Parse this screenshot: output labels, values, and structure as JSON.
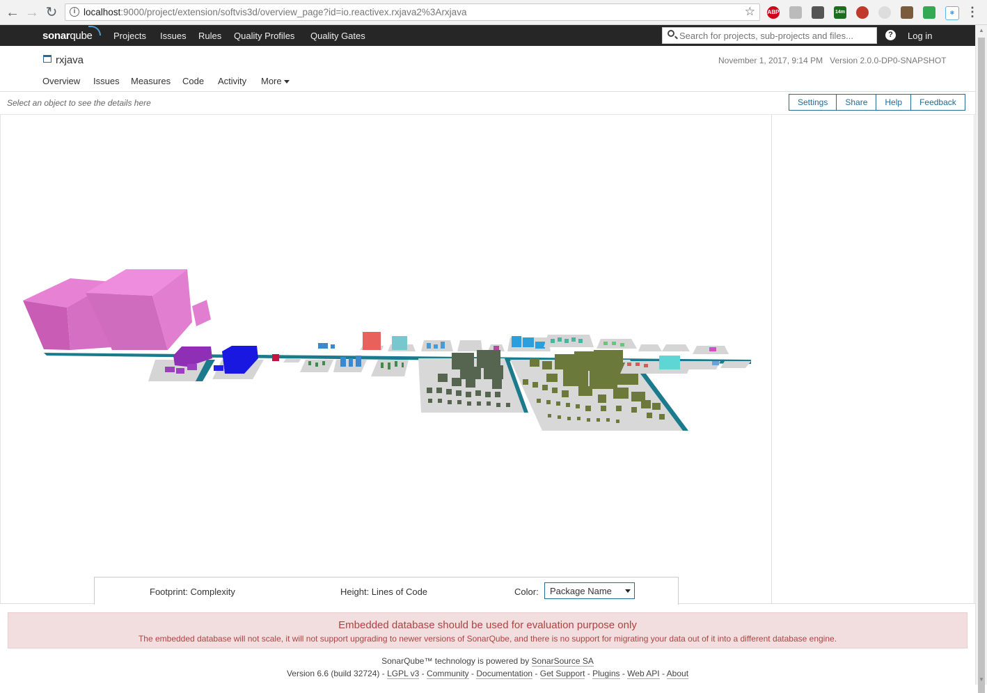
{
  "browser": {
    "url_host": "localhost",
    "url_rest": ":9000/project/extension/softvis3d/overview_page?id=io.reactivex.rxjava2%3Arxjava",
    "ext_abp": "ABP",
    "ext_timer": "14m"
  },
  "nav": {
    "logo_bold": "sonar",
    "logo_thin": "qube",
    "links": [
      "Projects",
      "Issues",
      "Rules",
      "Quality Profiles",
      "Quality Gates"
    ],
    "search_placeholder": "Search for projects, sub-projects and files...",
    "help": "?",
    "login": "Log in"
  },
  "project": {
    "name": "rxjava",
    "date": "November 1, 2017, 9:14 PM",
    "version": "Version 2.0.0-DP0-SNAPSHOT",
    "tabs": [
      "Overview",
      "Issues",
      "Measures",
      "Code",
      "Activity",
      "More"
    ]
  },
  "toolbar": {
    "hint": "Select an object to see the details here",
    "buttons": [
      "Settings",
      "Share",
      "Help",
      "Feedback"
    ]
  },
  "legend": {
    "footprint": "Footprint: Complexity",
    "height": "Height: Lines of Code",
    "color_label": "Color:",
    "color_value": "Package Name"
  },
  "warning": {
    "title": "Embedded database should be used for evaluation purpose only",
    "body": "The embedded database will not scale, it will not support upgrading to newer versions of SonarQube, and there is no support for migrating your data out of it into a different database engine."
  },
  "footer": {
    "line1_prefix": "SonarQube™ technology is powered by",
    "line1_link": "SonarSource SA",
    "version": "Version 6.6 (build 32724)",
    "links": [
      "LGPL v3",
      "Community",
      "Documentation",
      "Get Support",
      "Plugins",
      "Web API",
      "About"
    ]
  },
  "colors": {
    "nav_bg": "#262626",
    "accent": "#236a97",
    "road": "#1b7a8c",
    "pink": "#d966c2",
    "purple": "#8e2fb5",
    "blue": "#1818e0",
    "gray_green": "#55654f",
    "olive": "#6b7a3b"
  }
}
